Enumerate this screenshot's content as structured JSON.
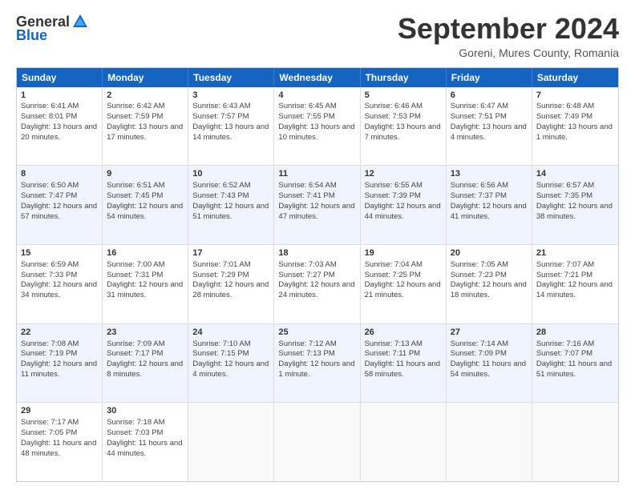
{
  "header": {
    "logo_general": "General",
    "logo_blue": "Blue",
    "month_title": "September 2024",
    "location": "Goreni, Mures County, Romania"
  },
  "days_of_week": [
    "Sunday",
    "Monday",
    "Tuesday",
    "Wednesday",
    "Thursday",
    "Friday",
    "Saturday"
  ],
  "rows": [
    [
      {
        "num": "1",
        "sunrise": "Sunrise: 6:41 AM",
        "sunset": "Sunset: 8:01 PM",
        "daylight": "Daylight: 13 hours and 20 minutes."
      },
      {
        "num": "2",
        "sunrise": "Sunrise: 6:42 AM",
        "sunset": "Sunset: 7:59 PM",
        "daylight": "Daylight: 13 hours and 17 minutes."
      },
      {
        "num": "3",
        "sunrise": "Sunrise: 6:43 AM",
        "sunset": "Sunset: 7:57 PM",
        "daylight": "Daylight: 13 hours and 14 minutes."
      },
      {
        "num": "4",
        "sunrise": "Sunrise: 6:45 AM",
        "sunset": "Sunset: 7:55 PM",
        "daylight": "Daylight: 13 hours and 10 minutes."
      },
      {
        "num": "5",
        "sunrise": "Sunrise: 6:46 AM",
        "sunset": "Sunset: 7:53 PM",
        "daylight": "Daylight: 13 hours and 7 minutes."
      },
      {
        "num": "6",
        "sunrise": "Sunrise: 6:47 AM",
        "sunset": "Sunset: 7:51 PM",
        "daylight": "Daylight: 13 hours and 4 minutes."
      },
      {
        "num": "7",
        "sunrise": "Sunrise: 6:48 AM",
        "sunset": "Sunset: 7:49 PM",
        "daylight": "Daylight: 13 hours and 1 minute."
      }
    ],
    [
      {
        "num": "8",
        "sunrise": "Sunrise: 6:50 AM",
        "sunset": "Sunset: 7:47 PM",
        "daylight": "Daylight: 12 hours and 57 minutes."
      },
      {
        "num": "9",
        "sunrise": "Sunrise: 6:51 AM",
        "sunset": "Sunset: 7:45 PM",
        "daylight": "Daylight: 12 hours and 54 minutes."
      },
      {
        "num": "10",
        "sunrise": "Sunrise: 6:52 AM",
        "sunset": "Sunset: 7:43 PM",
        "daylight": "Daylight: 12 hours and 51 minutes."
      },
      {
        "num": "11",
        "sunrise": "Sunrise: 6:54 AM",
        "sunset": "Sunset: 7:41 PM",
        "daylight": "Daylight: 12 hours and 47 minutes."
      },
      {
        "num": "12",
        "sunrise": "Sunrise: 6:55 AM",
        "sunset": "Sunset: 7:39 PM",
        "daylight": "Daylight: 12 hours and 44 minutes."
      },
      {
        "num": "13",
        "sunrise": "Sunrise: 6:56 AM",
        "sunset": "Sunset: 7:37 PM",
        "daylight": "Daylight: 12 hours and 41 minutes."
      },
      {
        "num": "14",
        "sunrise": "Sunrise: 6:57 AM",
        "sunset": "Sunset: 7:35 PM",
        "daylight": "Daylight: 12 hours and 38 minutes."
      }
    ],
    [
      {
        "num": "15",
        "sunrise": "Sunrise: 6:59 AM",
        "sunset": "Sunset: 7:33 PM",
        "daylight": "Daylight: 12 hours and 34 minutes."
      },
      {
        "num": "16",
        "sunrise": "Sunrise: 7:00 AM",
        "sunset": "Sunset: 7:31 PM",
        "daylight": "Daylight: 12 hours and 31 minutes."
      },
      {
        "num": "17",
        "sunrise": "Sunrise: 7:01 AM",
        "sunset": "Sunset: 7:29 PM",
        "daylight": "Daylight: 12 hours and 28 minutes."
      },
      {
        "num": "18",
        "sunrise": "Sunrise: 7:03 AM",
        "sunset": "Sunset: 7:27 PM",
        "daylight": "Daylight: 12 hours and 24 minutes."
      },
      {
        "num": "19",
        "sunrise": "Sunrise: 7:04 AM",
        "sunset": "Sunset: 7:25 PM",
        "daylight": "Daylight: 12 hours and 21 minutes."
      },
      {
        "num": "20",
        "sunrise": "Sunrise: 7:05 AM",
        "sunset": "Sunset: 7:23 PM",
        "daylight": "Daylight: 12 hours and 18 minutes."
      },
      {
        "num": "21",
        "sunrise": "Sunrise: 7:07 AM",
        "sunset": "Sunset: 7:21 PM",
        "daylight": "Daylight: 12 hours and 14 minutes."
      }
    ],
    [
      {
        "num": "22",
        "sunrise": "Sunrise: 7:08 AM",
        "sunset": "Sunset: 7:19 PM",
        "daylight": "Daylight: 12 hours and 11 minutes."
      },
      {
        "num": "23",
        "sunrise": "Sunrise: 7:09 AM",
        "sunset": "Sunset: 7:17 PM",
        "daylight": "Daylight: 12 hours and 8 minutes."
      },
      {
        "num": "24",
        "sunrise": "Sunrise: 7:10 AM",
        "sunset": "Sunset: 7:15 PM",
        "daylight": "Daylight: 12 hours and 4 minutes."
      },
      {
        "num": "25",
        "sunrise": "Sunrise: 7:12 AM",
        "sunset": "Sunset: 7:13 PM",
        "daylight": "Daylight: 12 hours and 1 minute."
      },
      {
        "num": "26",
        "sunrise": "Sunrise: 7:13 AM",
        "sunset": "Sunset: 7:11 PM",
        "daylight": "Daylight: 11 hours and 58 minutes."
      },
      {
        "num": "27",
        "sunrise": "Sunrise: 7:14 AM",
        "sunset": "Sunset: 7:09 PM",
        "daylight": "Daylight: 11 hours and 54 minutes."
      },
      {
        "num": "28",
        "sunrise": "Sunrise: 7:16 AM",
        "sunset": "Sunset: 7:07 PM",
        "daylight": "Daylight: 11 hours and 51 minutes."
      }
    ],
    [
      {
        "num": "29",
        "sunrise": "Sunrise: 7:17 AM",
        "sunset": "Sunset: 7:05 PM",
        "daylight": "Daylight: 11 hours and 48 minutes."
      },
      {
        "num": "30",
        "sunrise": "Sunrise: 7:18 AM",
        "sunset": "Sunset: 7:03 PM",
        "daylight": "Daylight: 11 hours and 44 minutes."
      },
      {
        "num": "",
        "sunrise": "",
        "sunset": "",
        "daylight": ""
      },
      {
        "num": "",
        "sunrise": "",
        "sunset": "",
        "daylight": ""
      },
      {
        "num": "",
        "sunrise": "",
        "sunset": "",
        "daylight": ""
      },
      {
        "num": "",
        "sunrise": "",
        "sunset": "",
        "daylight": ""
      },
      {
        "num": "",
        "sunrise": "",
        "sunset": "",
        "daylight": ""
      }
    ]
  ]
}
